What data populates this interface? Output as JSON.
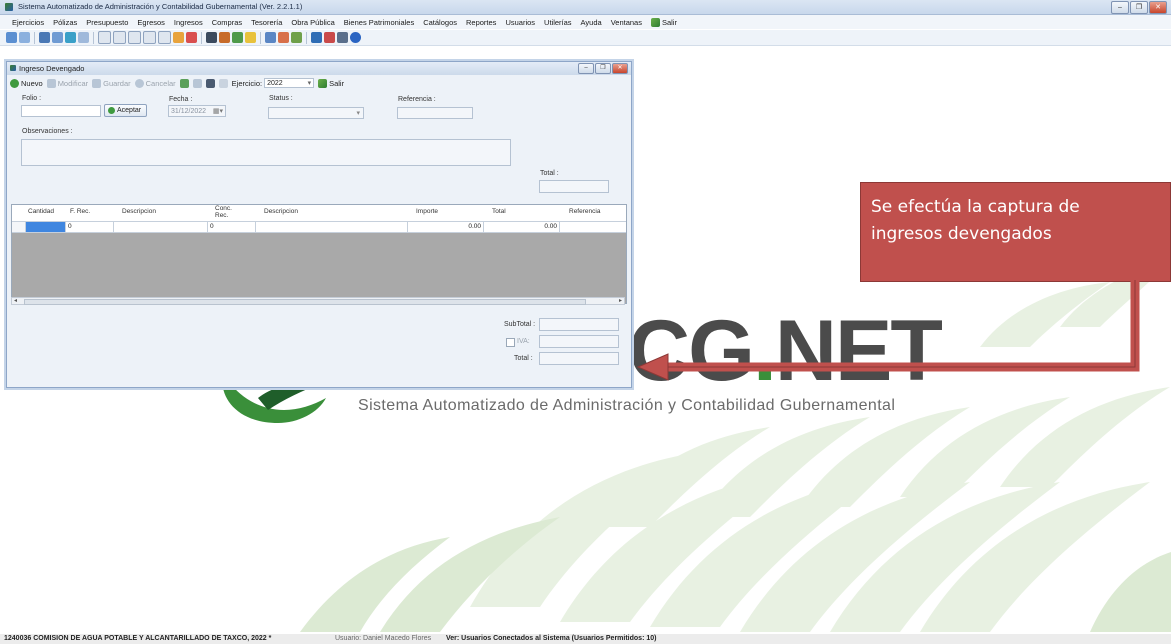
{
  "window": {
    "title": "Sistema Automatizado de Administración y Contabilidad Gubernamental  (Ver. 2.2.1.1)"
  },
  "menu": [
    "Ejercicios",
    "Pólizas",
    "Presupuesto",
    "Egresos",
    "Ingresos",
    "Compras",
    "Tesorería",
    "Obra Pública",
    "Bienes Patrimoniales",
    "Catálogos",
    "Reportes",
    "Usuarios",
    "Utilerías",
    "Ayuda",
    "Ventanas",
    "Salir"
  ],
  "background": {
    "logo_text_a": "CG",
    "logo_text_dot": ".",
    "logo_text_b": "NET",
    "tagline": "Sistema Automatizado de Administración y Contabilidad Gubernamental"
  },
  "child": {
    "title": "Ingreso Devengado",
    "toolbar": {
      "nuevo": "Nuevo",
      "modificar": "Modificar",
      "guardar": "Guardar",
      "cancelar": "Cancelar",
      "ejercicio_label": "Ejercicio:",
      "ejercicio_value": "2022",
      "salir": "Salir"
    },
    "form": {
      "folio_label": "Folio :",
      "folio_value": "",
      "aceptar": "Aceptar",
      "fecha_label": "Fecha :",
      "fecha_value": "31/12/2022",
      "status_label": "Status :",
      "status_value": "",
      "referencia_label": "Referencia :",
      "observaciones_label": "Observaciones :",
      "total_label": "Total :"
    },
    "grid": {
      "columns": [
        "Cantidad",
        "F. Rec.",
        "Descripcion",
        "Conc. Rec.",
        "Descripcion",
        "Importe",
        "Total",
        "Referencia"
      ],
      "row": {
        "cantidad": "",
        "f_rec": "0",
        "descripcion": "",
        "conc_rec": "0",
        "descripcion2": "",
        "importe": "0.00",
        "total": "0.00",
        "referencia": ""
      }
    },
    "totals": {
      "subtotal_label": "SubTotal :",
      "iva_label": "IVA:",
      "total_label": "Total :"
    }
  },
  "callout": {
    "line1": "Se efectúa la captura de",
    "line2": "ingresos  devengados",
    "color": "#c0504d"
  },
  "status": {
    "org": "1240036 COMISION DE AGUA POTABLE Y ALCANTARILLADO DE TAXCO, 2022 *",
    "user": "Usuario: Daniel Macedo Flores",
    "connected": "Ver: Usuarios Conectados al Sistema   (Usuarios Permitidos: 10)"
  }
}
